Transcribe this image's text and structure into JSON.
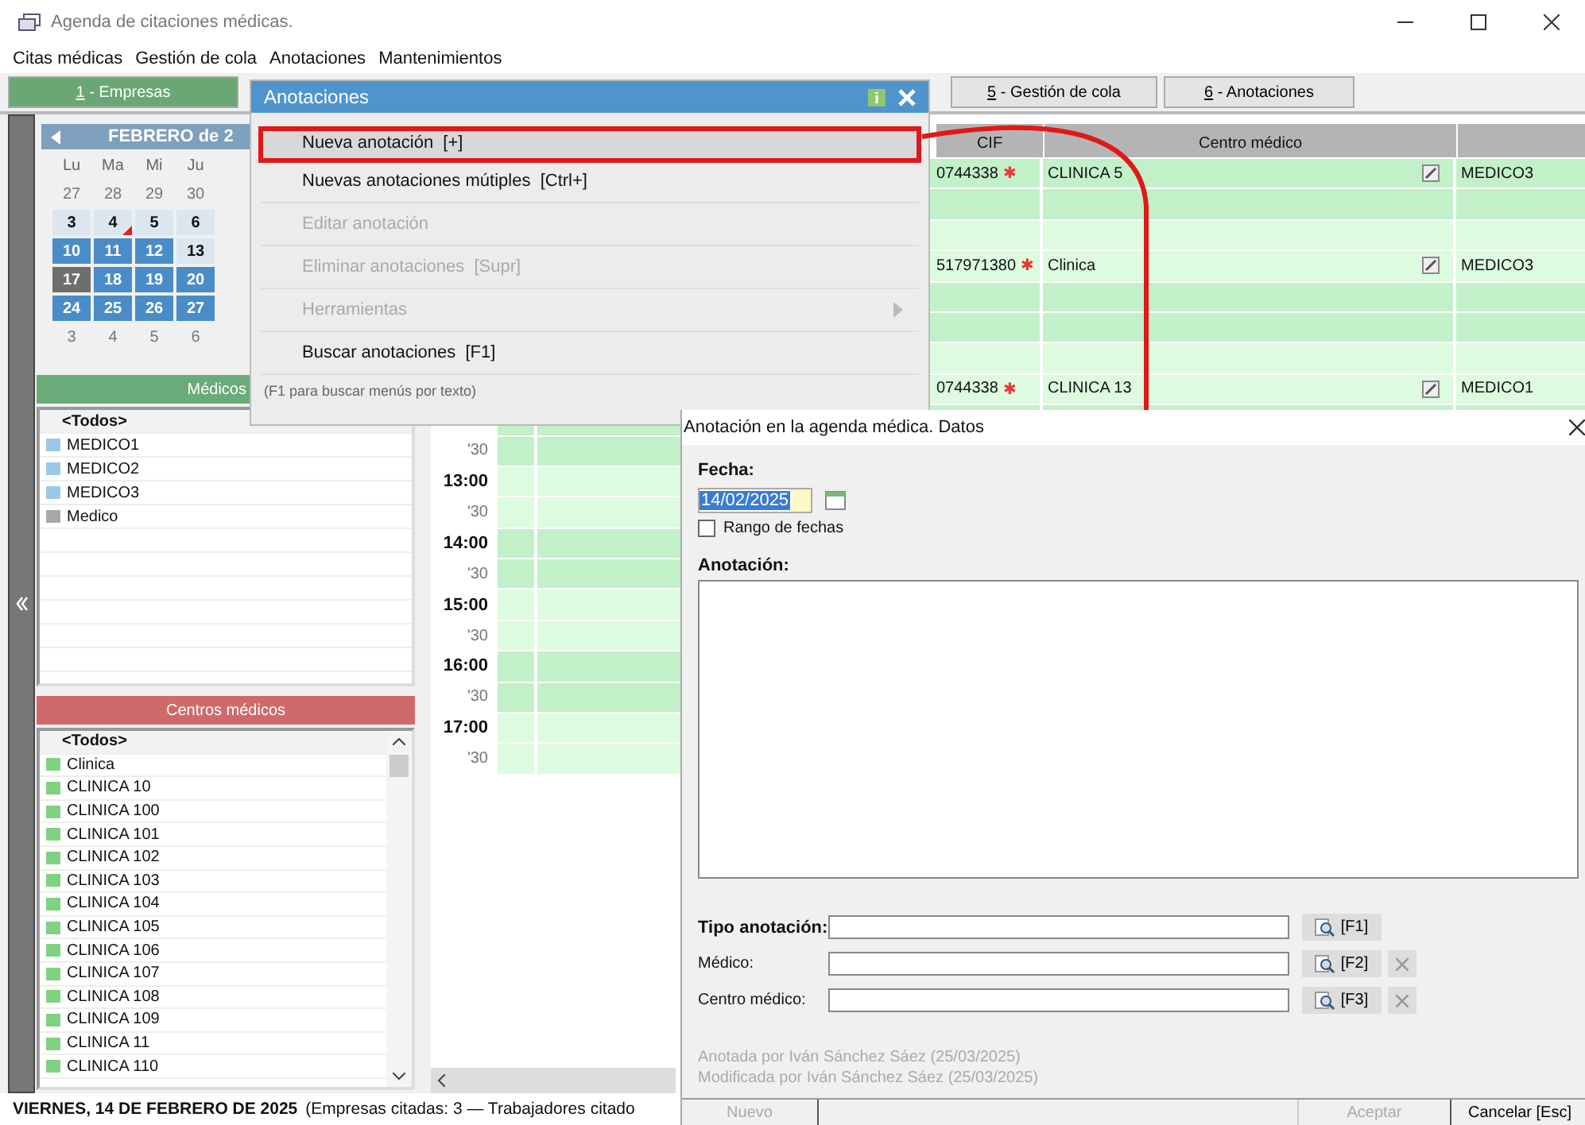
{
  "window": {
    "title": "Agenda de citaciones médicas."
  },
  "menu_bar": [
    "Citas médicas",
    "Gestión de cola",
    "Anotaciones",
    "Mantenimientos"
  ],
  "tabs": [
    {
      "key": "1",
      "label": "- Empresas",
      "selected": true
    },
    {
      "key": "5",
      "label": "- Gestión de cola",
      "selected": false
    },
    {
      "key": "6",
      "label": "- Anotaciones",
      "selected": false
    }
  ],
  "calendar": {
    "month": "FEBRERO de 2",
    "weekdays": [
      "Lu",
      "Ma",
      "Mi",
      "Ju"
    ],
    "weeks": [
      [
        {
          "day": "27",
          "kind": "other",
          "marked": false
        },
        {
          "day": "28",
          "kind": "other",
          "marked": false
        },
        {
          "day": "29",
          "kind": "other",
          "marked": false
        },
        {
          "day": "30",
          "kind": "other",
          "marked": false
        }
      ],
      [
        {
          "day": "3",
          "kind": "free",
          "marked": false
        },
        {
          "day": "4",
          "kind": "free",
          "marked": true
        },
        {
          "day": "5",
          "kind": "free",
          "marked": false
        },
        {
          "day": "6",
          "kind": "free",
          "marked": false
        }
      ],
      [
        {
          "day": "10",
          "kind": "busy",
          "marked": false
        },
        {
          "day": "11",
          "kind": "busy",
          "marked": false
        },
        {
          "day": "12",
          "kind": "busy",
          "marked": false
        },
        {
          "day": "13",
          "kind": "free",
          "marked": false
        }
      ],
      [
        {
          "day": "17",
          "kind": "current",
          "marked": false
        },
        {
          "day": "18",
          "kind": "busy",
          "marked": false
        },
        {
          "day": "19",
          "kind": "busy",
          "marked": false
        },
        {
          "day": "20",
          "kind": "busy",
          "marked": false
        }
      ],
      [
        {
          "day": "24",
          "kind": "busy",
          "marked": false
        },
        {
          "day": "25",
          "kind": "busy",
          "marked": false
        },
        {
          "day": "26",
          "kind": "busy",
          "marked": false
        },
        {
          "day": "27",
          "kind": "busy",
          "marked": false
        }
      ],
      [
        {
          "day": "3",
          "kind": "other",
          "marked": false
        },
        {
          "day": "4",
          "kind": "other",
          "marked": false
        },
        {
          "day": "5",
          "kind": "other",
          "marked": false
        },
        {
          "day": "6",
          "kind": "other",
          "marked": false
        }
      ]
    ]
  },
  "doctors": {
    "title": "Médicos",
    "header": "<Todos>",
    "items": [
      {
        "name": "MEDICO1",
        "color": "#9cc8e8"
      },
      {
        "name": "MEDICO2",
        "color": "#9cc8e8"
      },
      {
        "name": "MEDICO3",
        "color": "#9cc8e8"
      },
      {
        "name": "Medico",
        "color": "#a8a8a8"
      }
    ]
  },
  "centres": {
    "title": "Centros médicos",
    "header": "<Todos>",
    "items": [
      "Clinica",
      "CLINICA 10",
      "CLINICA 100",
      "CLINICA 101",
      "CLINICA 102",
      "CLINICA 103",
      "CLINICA 104",
      "CLINICA 105",
      "CLINICA 106",
      "CLINICA 107",
      "CLINICA 108",
      "CLINICA 109",
      "CLINICA 11",
      "CLINICA 110"
    ]
  },
  "schedule": {
    "columns": [
      "CIF",
      "Centro médico"
    ],
    "rows": [
      {
        "kind": "dark",
        "cif": "0744338",
        "cif_mark": "✱",
        "centre": "CLINICA 5",
        "doctor": "MEDICO3"
      },
      {
        "kind": "dark"
      },
      {
        "kind": "light"
      },
      {
        "kind": "light",
        "cif": "517971380",
        "cif_mark": "✱",
        "centre": "Clinica",
        "doctor": "MEDICO3"
      },
      {
        "kind": "dark"
      },
      {
        "kind": "dark"
      },
      {
        "kind": "light"
      },
      {
        "kind": "light",
        "cif": "0744338",
        "cif_mark": "✱",
        "centre": "CLINICA 13",
        "doctor": "MEDICO1"
      },
      {
        "kind": "dark"
      },
      {
        "kind": "dark",
        "time": "'30",
        "major": false
      },
      {
        "kind": "light",
        "time": "13:00",
        "major": true
      },
      {
        "kind": "light",
        "time": "'30",
        "major": false
      },
      {
        "kind": "dark",
        "time": "14:00",
        "major": true
      },
      {
        "kind": "dark",
        "time": "'30",
        "major": false
      },
      {
        "kind": "light",
        "time": "15:00",
        "major": true
      },
      {
        "kind": "light",
        "time": "'30",
        "major": false
      },
      {
        "kind": "dark",
        "time": "16:00",
        "major": true
      },
      {
        "kind": "dark",
        "time": "'30",
        "major": false
      },
      {
        "kind": "light",
        "time": "17:00",
        "major": true
      },
      {
        "kind": "light",
        "time": "'30",
        "major": false
      }
    ]
  },
  "status_bar": {
    "date": "VIERNES, 14 DE FEBRERO DE 2025",
    "summary": "(Empresas citadas: 3 — Trabajadores citado"
  },
  "popup_menu": {
    "title": "Anotaciones",
    "items": [
      {
        "label": "Nueva anotación",
        "shortcut": "[+]",
        "selected": true,
        "disabled": false,
        "submenu": false
      },
      {
        "label": "Nuevas anotaciones mútiples",
        "shortcut": "[Ctrl+]",
        "selected": false,
        "disabled": false,
        "submenu": false
      },
      {
        "label": "Editar anotación",
        "selected": false,
        "disabled": true,
        "submenu": false
      },
      {
        "label": "Eliminar anotaciones",
        "shortcut": "[Supr]",
        "selected": false,
        "disabled": true,
        "submenu": false
      },
      {
        "label": "Herramientas",
        "selected": false,
        "disabled": true,
        "submenu": true
      },
      {
        "label": "Buscar anotaciones",
        "shortcut": "[F1]",
        "selected": false,
        "disabled": false,
        "submenu": false
      }
    ],
    "hint": "(F1 para buscar menús por texto)"
  },
  "dialog": {
    "title": "Anotación en la agenda médica. Datos",
    "date_label": "Fecha:",
    "date_value": "14/02/2025",
    "range": {
      "label": "Rango de fechas",
      "checked": false
    },
    "note_label": "Anotación:",
    "fields": [
      {
        "label": "Tipo anotación:",
        "required": true,
        "lookup": "[F1]",
        "clearable": false
      },
      {
        "label": "Médico:",
        "required": false,
        "lookup": "[F2]",
        "clearable": true
      },
      {
        "label": "Centro médico:",
        "required": false,
        "lookup": "[F3]",
        "clearable": true
      }
    ],
    "audit": [
      "Anotada por Iván Sánchez Sáez (25/03/2025)",
      "Modificada por Iván Sánchez Sáez (25/03/2025)"
    ],
    "buttons": [
      {
        "label": "Nuevo",
        "disabled": true
      },
      {
        "label": "Aceptar",
        "disabled": true
      },
      {
        "label": "Cancelar [Esc]",
        "disabled": false
      }
    ]
  }
}
